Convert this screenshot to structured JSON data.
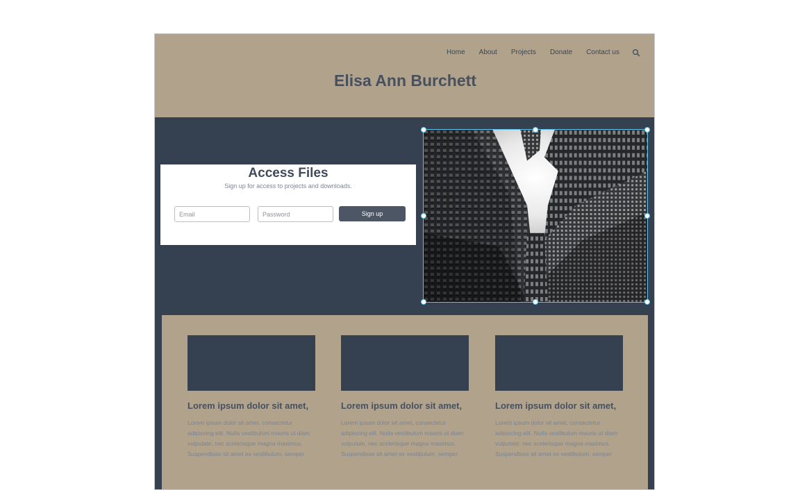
{
  "nav": {
    "items": [
      "Home",
      "About",
      "Projects",
      "Donate",
      "Contact us"
    ],
    "search_icon": "search-icon"
  },
  "site": {
    "title": "Elisa Ann Burchett"
  },
  "access": {
    "title": "Access Files",
    "subtitle": "Sign up for access to projects and downloads.",
    "email_placeholder": "Email",
    "password_placeholder": "Password",
    "signup_label": "Sign up"
  },
  "cards": [
    {
      "title": "Lorem ipsum dolor sit amet,",
      "body": "Lorem ipsum dolor sit amet, consectetur adipiscing elit. Nulla vestibulum mauris ut diam vulputate, nec scelerisque magna maximus. Suspendisse sit amet ex vestibulum, semper nulla quis, consequat arcu."
    },
    {
      "title": "Lorem ipsum dolor sit amet,",
      "body": "Lorem ipsum dolor sit amet, consectetur adipiscing elit. Nulla vestibulum mauris ut diam vulputate, nec scelerisque magna maximus. Suspendisse sit amet ex vestibulum, semper nulla quis, consequat arcu."
    },
    {
      "title": "Lorem ipsum dolor sit amet,",
      "body": "Lorem ipsum dolor sit amet, consectetur adipiscing elit. Nulla vestibulum mauris ut diam vulputate, nec scelerisque magna maximus. Suspendisse sit amet ex vestibulum, semper nulla quis, consequat arcu."
    }
  ],
  "colors": {
    "header_bg": "#b1a28c",
    "dark_bg": "#354050",
    "title_text": "#47505f",
    "selection": "#5ec8f0"
  }
}
